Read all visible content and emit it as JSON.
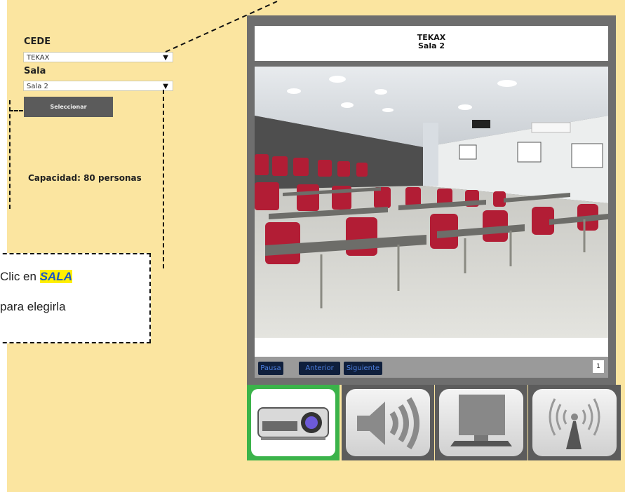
{
  "form": {
    "cede_label": "CEDE",
    "cede_value": "TEKAX",
    "sala_label": "Sala",
    "sala_value": "Sala 2",
    "select_button": "Seleccionar",
    "capacity": "Capacidad: 80 personas"
  },
  "callout": {
    "line1_prefix": "Clic en ",
    "line1_highlight": "SALA",
    "line2": "para elegirla"
  },
  "viewer": {
    "title": "TEKAX",
    "subtitle": "Sala 2",
    "controls": {
      "pause": "Pausa",
      "previous": "Anterior",
      "next": "Siguiente"
    },
    "counter": "1"
  },
  "tiles": [
    {
      "icon": "projector-icon",
      "selected": true
    },
    {
      "icon": "speaker-icon",
      "selected": false
    },
    {
      "icon": "monitor-icon",
      "selected": false
    },
    {
      "icon": "wifi-antenna-icon",
      "selected": false
    }
  ],
  "colors": {
    "panel_bg": "#fbe5a0",
    "selected_border": "#3bb34a",
    "button_bg": "#5b5b5b"
  }
}
